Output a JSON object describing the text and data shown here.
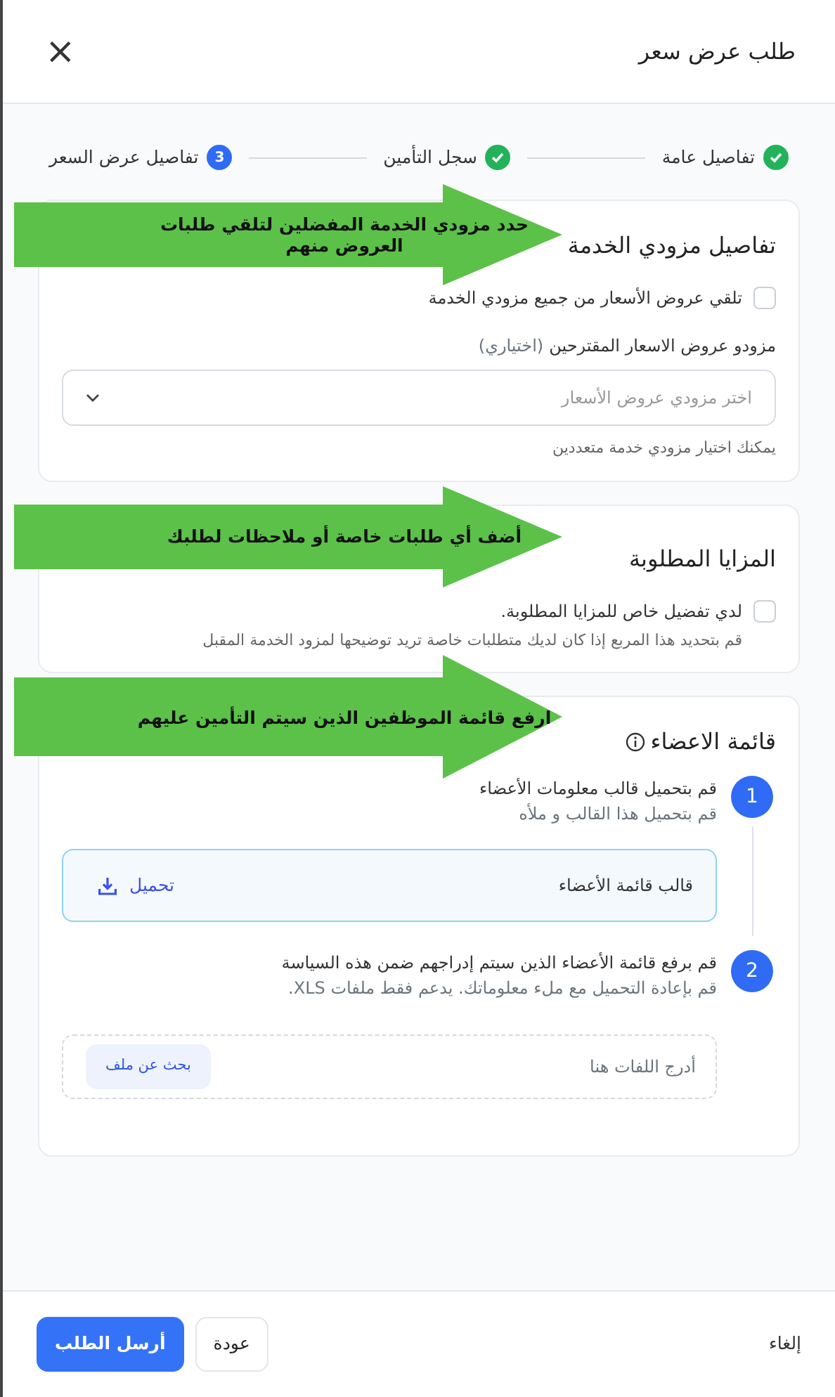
{
  "dialog": {
    "title": "طلب عرض سعر",
    "close": "×"
  },
  "steps": [
    {
      "label": "تفاصيل عامة",
      "done": true
    },
    {
      "label": "سجل التأمين",
      "done": true
    },
    {
      "label": "تفاصيل عرض السعر",
      "done": false,
      "number": "3"
    }
  ],
  "provider_section": {
    "title": "تفاصيل مزودي الخدمة",
    "callout": "حدد مزودي الخدمة المفضلين لتلقي طلبات العروض منهم",
    "all_providers_checkbox": {
      "label": "تلقي عروض الأسعار من جميع مزودي الخدمة",
      "checked": false
    },
    "field_label": "مزودو عروض الاسعار المقترحين",
    "field_optional": "(اختياري)",
    "select": {
      "placeholder": "اختر مزودي عروض الأسعار"
    },
    "help": "يمكنك اختيار مزودي خدمة متعددين"
  },
  "benefits_section": {
    "title": "المزايا المطلوبة",
    "callout": "أضف أي طلبات خاصة أو ملاحظات لطلبك",
    "checkbox": {
      "label": "لدي تفضيل خاص للمزايا المطلوبة.",
      "checked": false
    },
    "help": "قم بتحديد هذا المربع إذا كان لديك متطلبات خاصة تريد توضيحها لمزود الخدمة المقبل"
  },
  "members_section": {
    "title": "قائمة الاعضاء",
    "callout": "ارفع قائمة الموظفين الذين سيتم التأمين عليهم",
    "steps": [
      {
        "number": "1",
        "title": "قم بتحميل قالب معلومات الأعضاء",
        "subtitle": "قم بتحميل هذا القالب و ملأه",
        "kind": "download",
        "file_label": "قالب قائمة الأعضاء",
        "action": "تحميل"
      },
      {
        "number": "2",
        "title": "قم برفع قائمة الأعضاء الذين سيتم إدراجهم ضمن هذه السياسة",
        "subtitle": "قم بإعادة التحميل مع ملء معلوماتك. يدعم فقط ملفات XLS.",
        "kind": "upload",
        "placeholder": "أدرج اللفات هنا",
        "action": "بحث عن ملف"
      }
    ]
  },
  "footer": {
    "cancel": "إلغاء",
    "back": "عودة",
    "submit": "أرسل الطلب"
  }
}
